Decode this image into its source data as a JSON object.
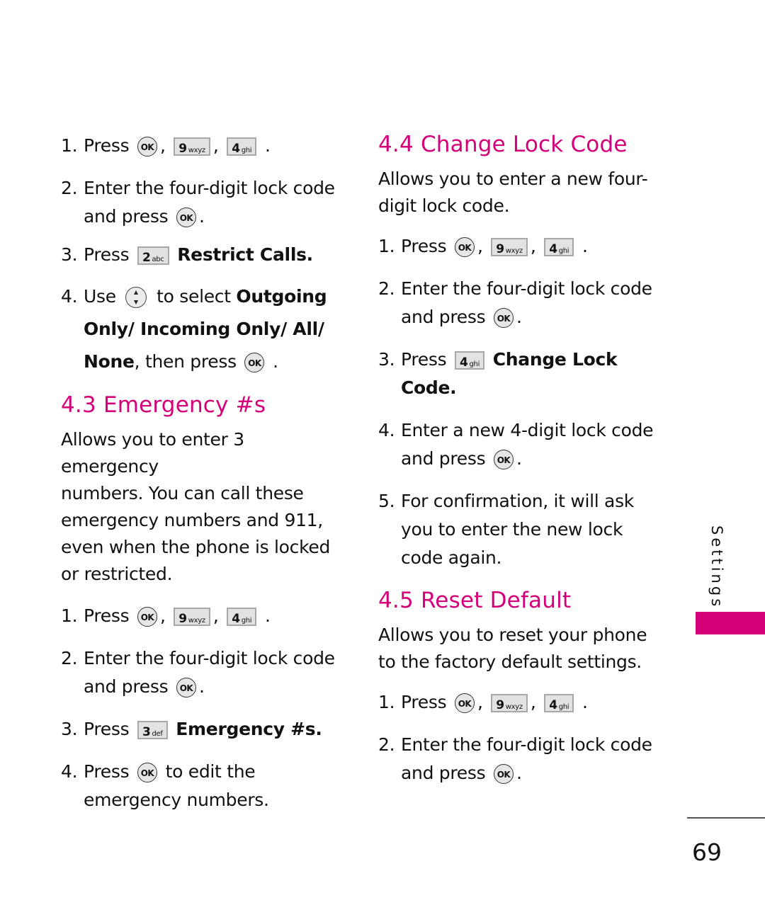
{
  "accent_color": "#d4007a",
  "left": {
    "intro_steps": [
      {
        "num": "1.",
        "prefix": "Press",
        "sep1": ",",
        "sep2": ",",
        "end": ".",
        "ok_icon": "OK",
        "key1": {
          "digit": "9",
          "letters": "wxyz"
        },
        "key2": {
          "digit": "4",
          "letters": "ghi"
        }
      },
      {
        "num": "2.",
        "text": "Enter the four-digit lock code",
        "line2": "and press",
        "ok_icon": "OK",
        "end": "."
      },
      {
        "num": "3.",
        "prefix": "Press",
        "key": {
          "digit": "2",
          "letters": "abc"
        },
        "bold": "Restrict Calls."
      },
      {
        "num": "4.",
        "prefix": "Use",
        "mid": "to select",
        "bold1": "Outgoing",
        "bold2": "Only/ Incoming Only/ All/",
        "bold3": "None",
        "tail": ", then press",
        "ok_icon": "OK",
        "end": "."
      }
    ],
    "section": {
      "title": "4.3 Emergency #s",
      "description": "Allows you to enter 3 emergency numbers. You can call these emergency numbers and 911, even when the phone is locked or restricted.",
      "desc_lines": [
        "Allows you to enter 3 emergency",
        "numbers. You can call these",
        "emergency numbers and 911,",
        "even when the phone is locked",
        "or restricted."
      ],
      "steps": [
        {
          "num": "1.",
          "prefix": "Press",
          "sep1": ",",
          "sep2": ",",
          "end": ".",
          "ok_icon": "OK",
          "key1": {
            "digit": "9",
            "letters": "wxyz"
          },
          "key2": {
            "digit": "4",
            "letters": "ghi"
          }
        },
        {
          "num": "2.",
          "text": "Enter the four-digit lock code",
          "line2": "and press",
          "ok_icon": "OK",
          "end": "."
        },
        {
          "num": "3.",
          "prefix": "Press",
          "key": {
            "digit": "3",
            "letters": "def"
          },
          "bold": "Emergency #s."
        },
        {
          "num": "4.",
          "prefix": "Press",
          "ok_icon": "OK",
          "tail": "to edit the",
          "line2": "emergency numbers."
        }
      ]
    }
  },
  "right": {
    "change_lock": {
      "title": "4.4 Change Lock Code",
      "desc_lines": [
        "Allows you to enter a new four-",
        "digit lock code."
      ],
      "steps": [
        {
          "num": "1.",
          "prefix": "Press",
          "sep1": ",",
          "sep2": ",",
          "end": ".",
          "ok_icon": "OK",
          "key1": {
            "digit": "9",
            "letters": "wxyz"
          },
          "key2": {
            "digit": "4",
            "letters": "ghi"
          }
        },
        {
          "num": "2.",
          "text": "Enter the four-digit lock code",
          "line2": "and press",
          "ok_icon": "OK",
          "end": "."
        },
        {
          "num": "3.",
          "prefix": "Press",
          "key": {
            "digit": "4",
            "letters": "ghi"
          },
          "bold": "Change Lock",
          "bold2": "Code."
        },
        {
          "num": "4.",
          "text": "Enter a new 4-digit lock code",
          "line2": "and press",
          "ok_icon": "OK",
          "end": "."
        },
        {
          "num": "5.",
          "lines": [
            "For confirmation, it will ask",
            "you to enter the new lock",
            "code again."
          ]
        }
      ]
    },
    "reset_default": {
      "title": "4.5 Reset Default",
      "desc_lines": [
        "Allows you to reset your phone",
        "to the factory default settings."
      ],
      "steps": [
        {
          "num": "1.",
          "prefix": "Press",
          "sep1": ",",
          "sep2": ",",
          "end": ".",
          "ok_icon": "OK",
          "key1": {
            "digit": "9",
            "letters": "wxyz"
          },
          "key2": {
            "digit": "4",
            "letters": "ghi"
          }
        },
        {
          "num": "2.",
          "text": "Enter the four-digit lock code",
          "line2": "and press",
          "ok_icon": "OK",
          "end": "."
        }
      ]
    }
  },
  "sidebar": {
    "label": "Settings"
  },
  "footer": {
    "page_number": "69"
  }
}
